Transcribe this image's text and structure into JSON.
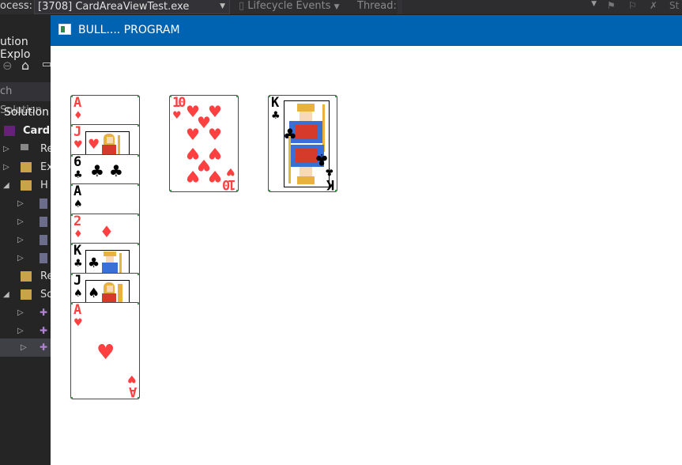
{
  "ide": {
    "process_label": "ocess:",
    "process_value": "[3708] CardAreaViewTest.exe",
    "lifecycle_label": "Lifecycle Events",
    "thread_label": "Thread:",
    "right_label": "St",
    "sidebar": {
      "title": "ution Explo",
      "search": "ch Solution",
      "solution": "Solution",
      "project": "Card",
      "items": [
        {
          "label": "Re"
        },
        {
          "label": "Ex"
        },
        {
          "label": "H"
        },
        {
          "label": "Re"
        },
        {
          "label": "Sc"
        }
      ]
    }
  },
  "window": {
    "title": "BULL.... PROGRAM"
  },
  "cards": {
    "column1": [
      {
        "rank": "A",
        "suit": "♦",
        "color": "red"
      },
      {
        "rank": "J",
        "suit": "♥",
        "color": "red"
      },
      {
        "rank": "6",
        "suit": "♣",
        "color": "black"
      },
      {
        "rank": "A",
        "suit": "♠",
        "color": "black"
      },
      {
        "rank": "2",
        "suit": "♦",
        "color": "red"
      },
      {
        "rank": "K",
        "suit": "♣",
        "color": "black"
      },
      {
        "rank": "J",
        "suit": "♠",
        "color": "black"
      },
      {
        "rank": "A",
        "suit": "♥",
        "color": "red"
      }
    ],
    "ten_hearts": {
      "rank": "10",
      "suit": "♥",
      "color": "red"
    },
    "king_clubs": {
      "rank": "K",
      "suit": "♣",
      "color": "black"
    }
  },
  "colors": {
    "titlebar": "#0063b1",
    "red_suit": "#ff4040",
    "card_corner": "#2a9d3a"
  }
}
